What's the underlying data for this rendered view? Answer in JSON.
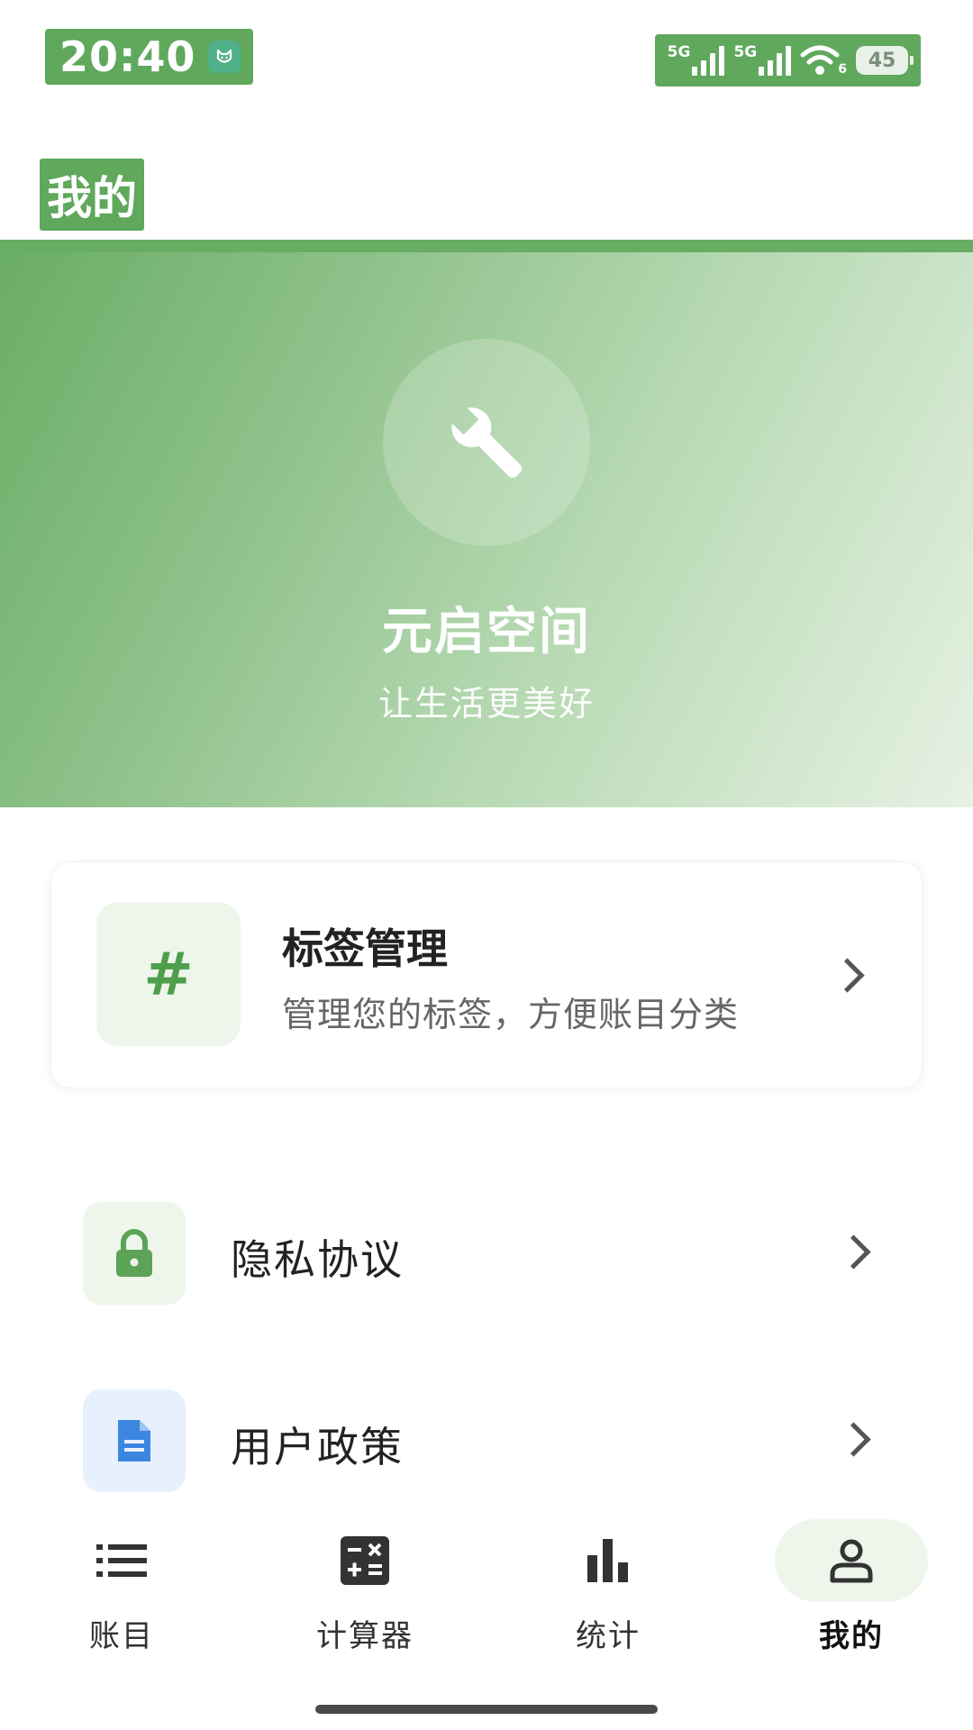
{
  "status_bar": {
    "time": "20:40",
    "network_1": "5G",
    "network_2": "5G",
    "wifi_label": "6",
    "battery": "45"
  },
  "header": {
    "title": "我的"
  },
  "hero": {
    "logo_icon": "wrench-icon",
    "title": "元启空间",
    "subtitle": "让生活更美好"
  },
  "tag_card": {
    "icon": "hash-icon",
    "icon_glyph": "#",
    "title": "标签管理",
    "description": "管理您的标签，方便账目分类"
  },
  "menu": {
    "privacy": {
      "icon": "lock-icon",
      "label": "隐私协议"
    },
    "policy": {
      "icon": "document-icon",
      "label": "用户政策"
    }
  },
  "bottom_nav": {
    "items": [
      {
        "label": "账目",
        "icon": "list-icon",
        "active": false
      },
      {
        "label": "计算器",
        "icon": "calculator-icon",
        "active": false
      },
      {
        "label": "统计",
        "icon": "bar-chart-icon",
        "active": false
      },
      {
        "label": "我的",
        "icon": "person-icon",
        "active": true
      }
    ]
  },
  "colors": {
    "brand_green": "#5fa85c",
    "hero_gradient_start": "#6aad66",
    "hero_gradient_end": "#e6f2e3",
    "policy_icon_blue": "#3d86e0"
  }
}
